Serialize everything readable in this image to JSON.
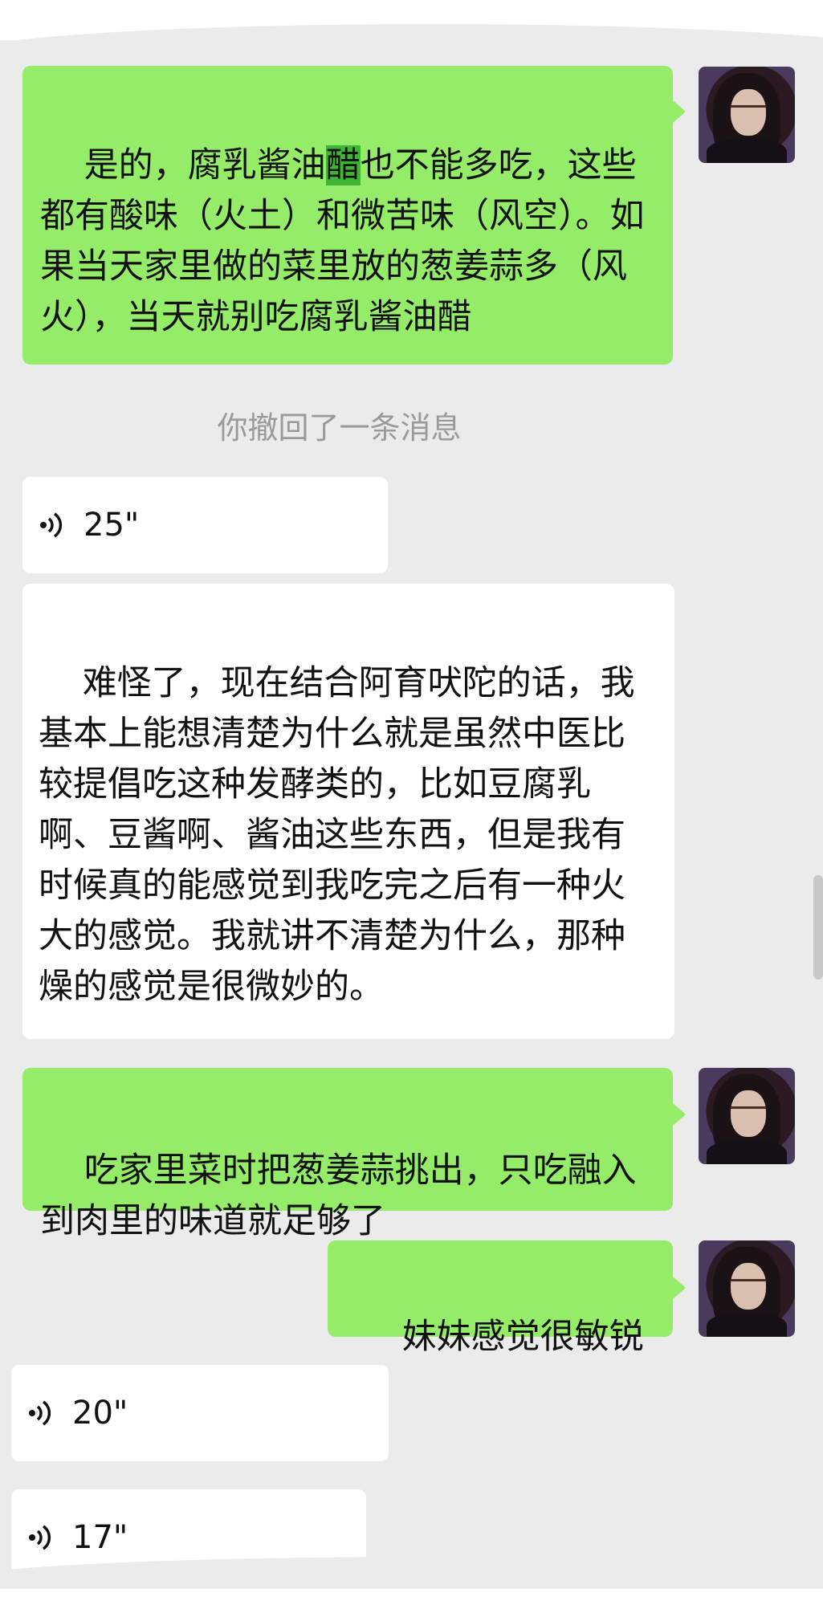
{
  "messages": {
    "m1": {
      "before": "是的，腐乳酱油",
      "highlight": "醋",
      "after": "也不能多吃，这些都有酸味（火土）和微苦味（风空）。如果当天家里做的菜里放的葱姜蒜多（风火），当天就别吃腐乳酱油醋"
    },
    "notice": "你撤回了一条消息",
    "voice1": "25\"",
    "m2": "难怪了，现在结合阿育吠陀的话，我基本上能想清楚为什么就是虽然中医比较提倡吃这种发酵类的，比如豆腐乳啊、豆酱啊、酱油这些东西，但是我有时候真的能感觉到我吃完之后有一种火大的感觉。我就讲不清楚为什么，那种燥的感觉是很微妙的。",
    "m3": "吃家里菜时把葱姜蒜挑出，只吃融入到肉里的味道就足够了",
    "m4": "妹妹感觉很敏锐",
    "voice2": "20\"",
    "voice3": "17\""
  },
  "icons": {
    "voice": "voice-wave-icon",
    "avatar": "avatar"
  },
  "colors": {
    "my_bubble": "#95ec69",
    "other_bubble": "#ffffff",
    "background": "#ebebeb",
    "highlight": "#3fb534"
  }
}
